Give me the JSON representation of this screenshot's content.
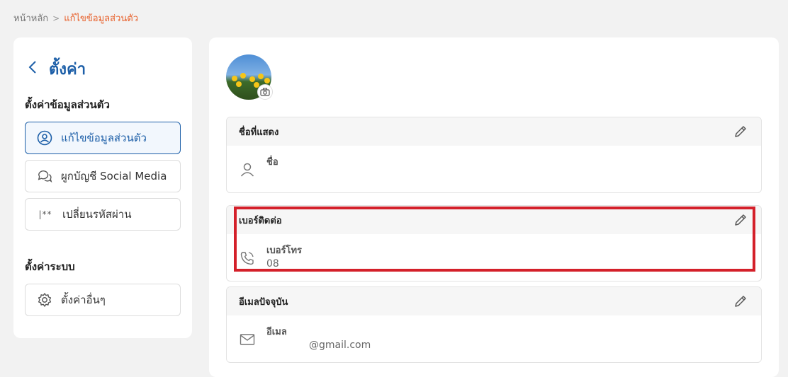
{
  "breadcrumb": {
    "home": "หน้าหลัก",
    "separator": ">",
    "current": "แก้ไขข้อมูลส่วนตัว"
  },
  "sidebar": {
    "title": "ตั้งค่า",
    "section_personal": "ตั้งค่าข้อมูลส่วนตัว",
    "items": [
      {
        "label": "แก้ไขข้อมูลส่วนตัว",
        "icon": "user-circle-icon",
        "active": true
      },
      {
        "label": "ผูกบัญชี Social Media",
        "icon": "chat-bubbles-icon",
        "active": false
      },
      {
        "label": "เปลี่ยนรหัสผ่าน",
        "icon": "password-icon",
        "icon_text": "|**",
        "active": false
      }
    ],
    "section_system": "ตั้งค่าระบบ",
    "system_items": [
      {
        "label": "ตั้งค่าอื่นๆ",
        "icon": "gear-icon"
      }
    ]
  },
  "profile": {
    "display_name": {
      "header": "ชื่อที่แสดง",
      "label": "ชื่อ",
      "value": ""
    },
    "contact": {
      "header": "เบอร์ติดต่อ",
      "label": "เบอร์โทร",
      "value": "08"
    },
    "email": {
      "header": "อีเมลปัจจุบัน",
      "label": "อีเมล",
      "value": "@gmail.com"
    }
  },
  "colors": {
    "accent": "#1d5fa8",
    "breadcrumb_active": "#e8612c",
    "highlight": "#d4202a"
  }
}
